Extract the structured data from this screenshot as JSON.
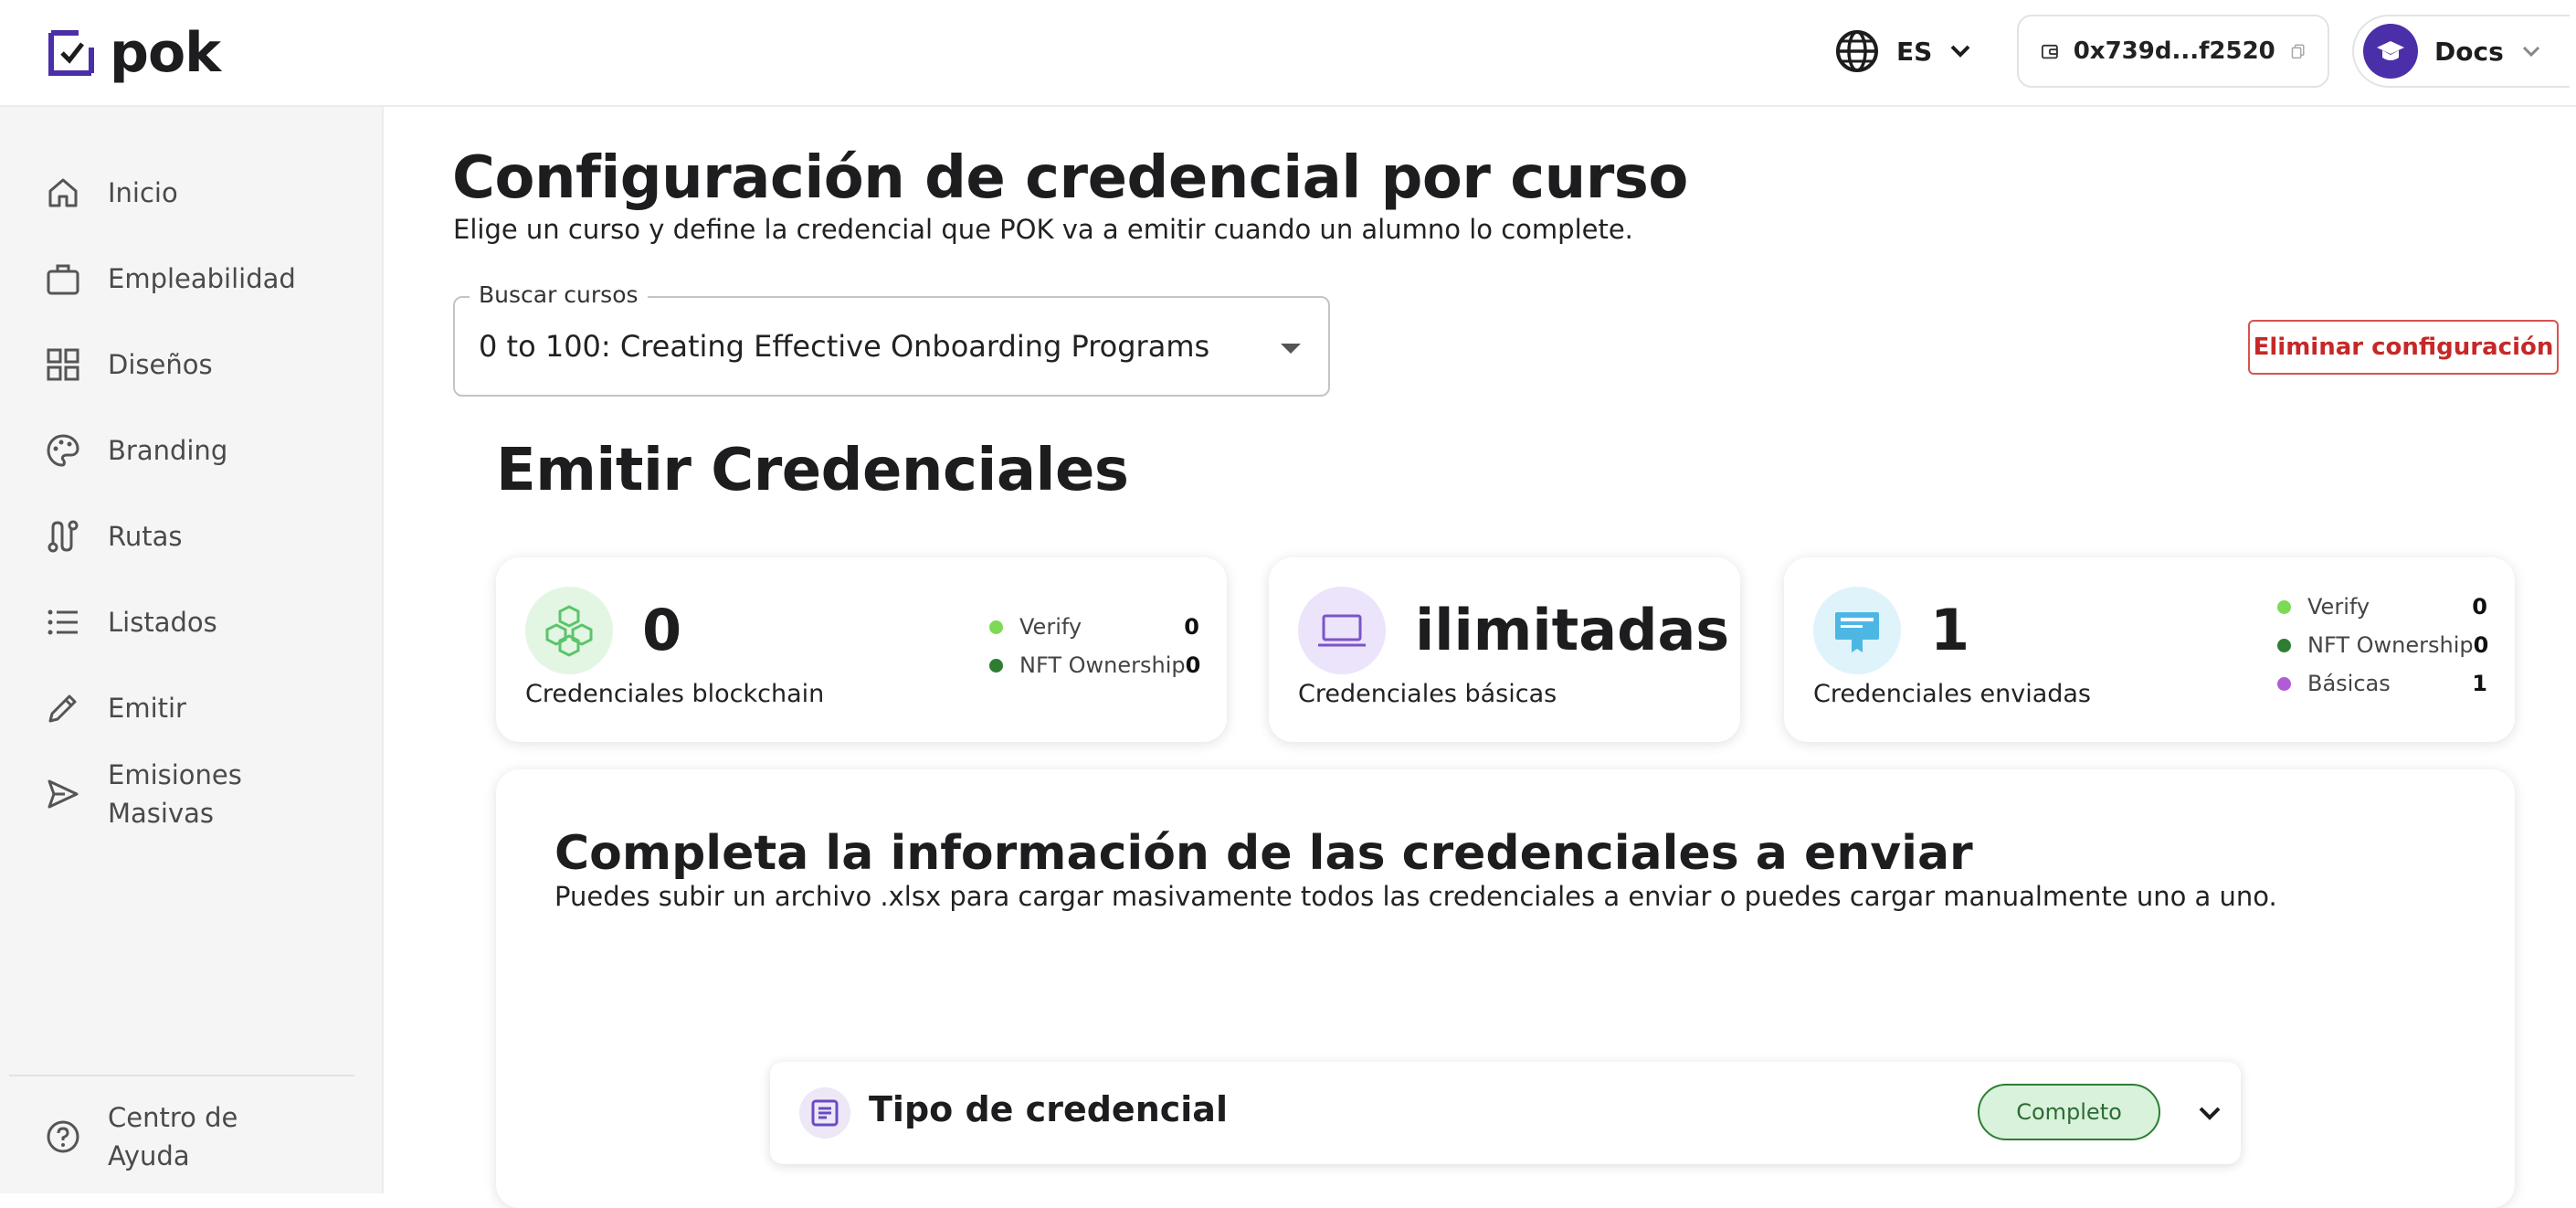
{
  "header": {
    "logo_text": "pok",
    "language": "ES",
    "wallet_address": "0x739d...f2520",
    "docs_label": "Docs"
  },
  "sidebar": {
    "items": [
      {
        "label": "Inicio",
        "icon": "home-icon"
      },
      {
        "label": "Empleabilidad",
        "icon": "briefcase-icon"
      },
      {
        "label": "Diseños",
        "icon": "grid-icon"
      },
      {
        "label": "Branding",
        "icon": "palette-icon"
      },
      {
        "label": "Rutas",
        "icon": "route-icon"
      },
      {
        "label": "Listados",
        "icon": "list-icon"
      },
      {
        "label": "Emitir",
        "icon": "pencil-icon"
      },
      {
        "label": "Emisiones Masivas",
        "icon": "send-icon"
      }
    ],
    "help": {
      "label": "Centro de Ayuda",
      "icon": "help-circle-icon"
    }
  },
  "page": {
    "title": "Configuración de credencial por curso",
    "subtitle": "Elige un curso y define la credencial que POK va a emitir cuando un alumno lo complete.",
    "course_search": {
      "label": "Buscar cursos",
      "value": "0 to 100: Creating Effective Onboarding Programs"
    },
    "delete_button": "Eliminar configuración",
    "section_title": "Emitir Credenciales"
  },
  "stats": {
    "blockchain": {
      "value": "0",
      "label": "Credenciales blockchain",
      "legend": [
        {
          "name": "Verify",
          "value": "0",
          "color": "#7ed957"
        },
        {
          "name": "NFT Ownership",
          "value": "0",
          "color": "#2e7d32"
        }
      ]
    },
    "basic": {
      "value": "ilimitadas",
      "label": "Credenciales básicas"
    },
    "sent": {
      "value": "1",
      "label": "Credenciales enviadas",
      "legend": [
        {
          "name": "Verify",
          "value": "0",
          "color": "#7ed957"
        },
        {
          "name": "NFT Ownership",
          "value": "0",
          "color": "#2e7d32"
        },
        {
          "name": "Básicas",
          "value": "1",
          "color": "#b05cd6"
        }
      ]
    }
  },
  "form": {
    "title": "Completa la información de las credenciales a enviar",
    "subtitle": "Puedes subir un archivo .xlsx para cargar masivamente todos las credenciales a enviar o puedes cargar manualmente uno a uno.",
    "accordion": {
      "title": "Tipo de credencial",
      "status": "Completo"
    }
  },
  "colors": {
    "brand": "#4b2fa8",
    "danger": "#c62828",
    "success": "#2e7d32"
  }
}
